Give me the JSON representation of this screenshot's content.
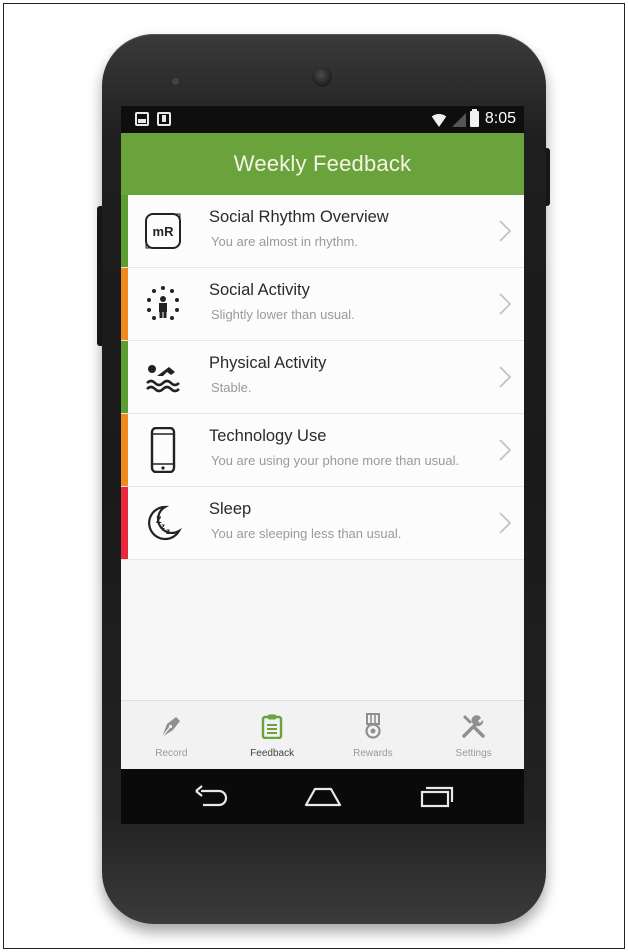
{
  "status_bar": {
    "time": "8:05",
    "icons": [
      "image-notification-icon",
      "download-notification-icon",
      "wifi-icon",
      "signal-icon",
      "battery-icon"
    ]
  },
  "app_bar": {
    "title": "Weekly Feedback"
  },
  "feedback_items": [
    {
      "title": "Social Rhythm Overview",
      "subtitle": "You are almost in rhythm.",
      "icon": "mr-logo-icon",
      "status_color": "#5c9d33"
    },
    {
      "title": "Social Activity",
      "subtitle": "Slightly lower than usual.",
      "icon": "social-activity-icon",
      "status_color": "#f08a1e"
    },
    {
      "title": "Physical Activity",
      "subtitle": "Stable.",
      "icon": "swimmer-icon",
      "status_color": "#5c9d33"
    },
    {
      "title": "Technology Use",
      "subtitle": "You are using your phone more than usual.",
      "icon": "smartphone-icon",
      "status_color": "#f08a1e"
    },
    {
      "title": "Sleep",
      "subtitle": "You are sleeping less than usual.",
      "icon": "sleep-moon-icon",
      "status_color": "#e8283a"
    }
  ],
  "icon_labels": {
    "mr_logo": "mR"
  },
  "tabs": [
    {
      "label": "Record",
      "icon": "pen-nib-icon",
      "active": false
    },
    {
      "label": "Feedback",
      "icon": "clipboard-icon",
      "active": true
    },
    {
      "label": "Rewards",
      "icon": "medal-icon",
      "active": false
    },
    {
      "label": "Settings",
      "icon": "wrench-screwdriver-icon",
      "active": false
    }
  ],
  "nav_bar": {
    "buttons": [
      "back-icon",
      "home-icon",
      "recents-icon"
    ]
  },
  "colors": {
    "app_bar": "#6aa23c",
    "active_tab": "#6aa23c",
    "title_text": "#f5f5e6"
  }
}
